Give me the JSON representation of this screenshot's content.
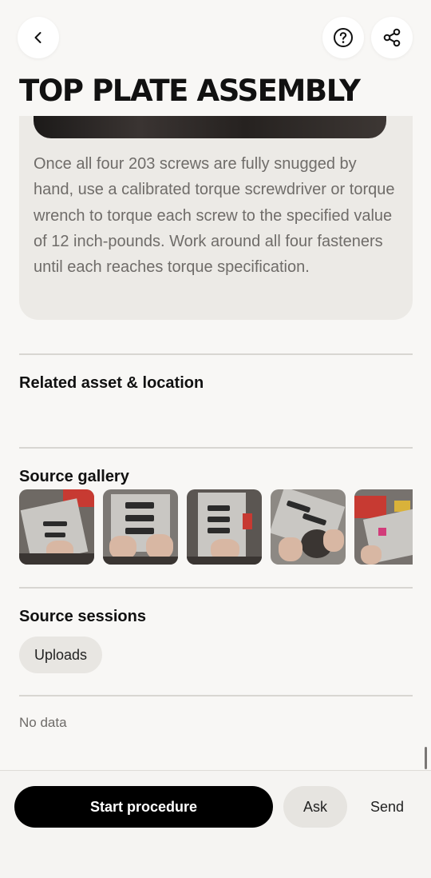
{
  "header": {
    "back_icon": "chevron-left-icon",
    "help_icon": "help-circle-icon",
    "share_icon": "share-icon"
  },
  "title": "TOP PLATE ASSEMBLY",
  "step": {
    "description": "Once all four 203 screws are fully snugged by hand, use a calibrated torque screwdriver or torque wrench to torque each screw to the specified value of 12 inch-pounds. Work around all four fasteners until each reaches torque specification."
  },
  "sections": {
    "related_asset": "Related asset & location",
    "source_gallery": "Source gallery",
    "source_sessions": "Source sessions"
  },
  "gallery": {
    "thumbnails": [
      "thumbnail-1",
      "thumbnail-2",
      "thumbnail-3",
      "thumbnail-4",
      "thumbnail-5"
    ]
  },
  "sessions": {
    "chip_label": "Uploads",
    "empty_text": "No data"
  },
  "actions": {
    "start_label": "Start procedure",
    "ask_label": "Ask",
    "send_label": "Send"
  },
  "colors": {
    "background": "#f8f7f5",
    "card": "#eceae6",
    "primary_button": "#000000"
  }
}
